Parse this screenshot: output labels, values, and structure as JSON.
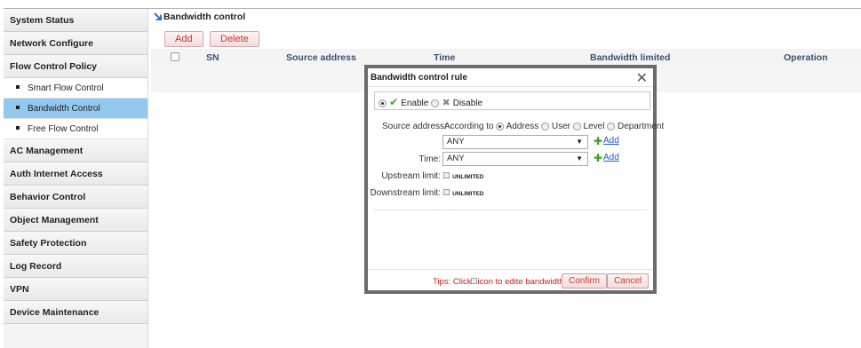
{
  "sidebar": {
    "items": [
      {
        "label": "System Status",
        "type": "section"
      },
      {
        "label": "Network Configure",
        "type": "section"
      },
      {
        "label": "Flow Control Policy",
        "type": "section"
      },
      {
        "label": "Smart Flow Control",
        "type": "sub"
      },
      {
        "label": "Bandwidth Control",
        "type": "sub",
        "active": true
      },
      {
        "label": "Free Flow Control",
        "type": "sub"
      },
      {
        "label": "AC Management",
        "type": "section"
      },
      {
        "label": "Auth Internet Access",
        "type": "section"
      },
      {
        "label": "Behavior Control",
        "type": "section"
      },
      {
        "label": "Object Management",
        "type": "section"
      },
      {
        "label": "Safety Protection",
        "type": "section"
      },
      {
        "label": "Log Record",
        "type": "section"
      },
      {
        "label": "VPN",
        "type": "section"
      },
      {
        "label": "Device Maintenance",
        "type": "section"
      }
    ]
  },
  "main": {
    "breadcrumb": "Bandwidth control",
    "toolbar": {
      "add_label": "Add",
      "delete_label": "Delete"
    },
    "table": {
      "columns": [
        "SN",
        "Source address",
        "Time",
        "Bandwidth limited",
        "Operation"
      ]
    }
  },
  "modal": {
    "title": "Bandwidth control rule",
    "close_icon": "close-icon",
    "enable_label": "Enable",
    "disable_label": "Disable",
    "source_address_label": "Source address:",
    "according_to_label": "According to",
    "according_options": [
      "Address",
      "User",
      "Level",
      "Department"
    ],
    "according_selected": "Address",
    "source_select_value": "ANY",
    "add_link": "Add",
    "time_label": "Time:",
    "time_select_value": "ANY",
    "upstream_label": "Upstream limit:",
    "upstream_value": "UNLIMITED",
    "downstream_label": "Downstream limit:",
    "downstream_value": "UNLIMITED",
    "tips_prefix": "Tips: Click",
    "tips_suffix": "icon to edite bandwidth",
    "confirm_label": "Confirm",
    "cancel_label": "Cancel"
  },
  "colors": {
    "active_nav": "#93c8ee",
    "button_text": "#c23a2a",
    "tips_text": "#d01a1a",
    "link": "#1b5bd6",
    "modal_border": "#6b6b6b"
  }
}
